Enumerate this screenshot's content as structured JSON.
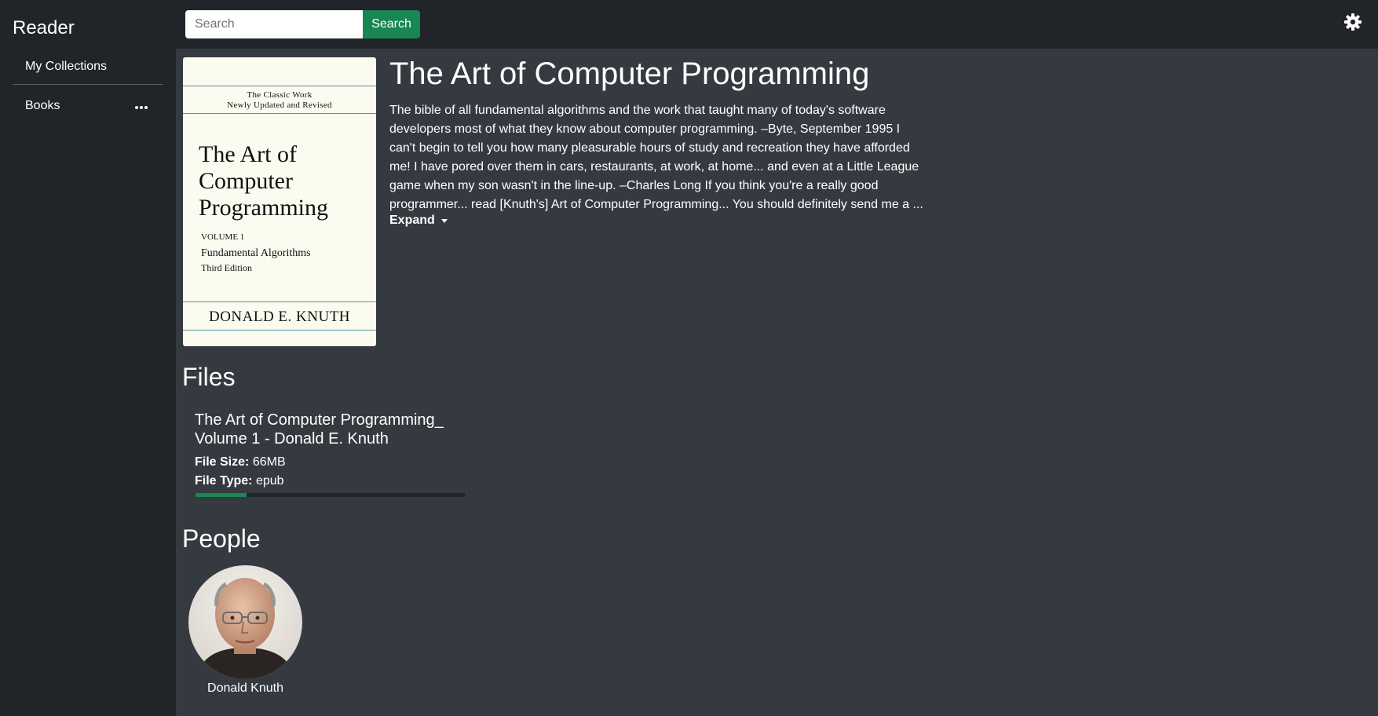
{
  "app": {
    "title": "Reader"
  },
  "sidebar": {
    "items": [
      {
        "label": "My Collections"
      },
      {
        "label": "Books"
      }
    ],
    "more_icon": "more-horizontal-icon"
  },
  "header": {
    "search": {
      "placeholder": "Search",
      "value": "",
      "button_label": "Search"
    },
    "settings_icon": "gear-icon"
  },
  "book": {
    "title": "The Art of Computer Programming",
    "description": " The bible of all fundamental algorithms and the work that taught many of today's software developers most of what they know about computer programming.  –Byte, September 1995    I can't begin to tell you how many pleasurable hours of study and recreation they have afforded me! I have pored over them in cars, restaurants, at work, at home... and even at a Little League game when my son wasn't in the line-up.  –Charles Long    If you think you're a really good programmer... read [Knuth's] Art of Computer Programming... You should definitely send me a ...",
    "expand_label": "Expand",
    "cover": {
      "tagline_1": "The Classic Work",
      "tagline_2": "Newly Updated and Revised",
      "title_line_1": "The Art of",
      "title_line_2": "Computer",
      "title_line_3": "Programming",
      "volume": "VOLUME 1",
      "subtitle": "Fundamental Algorithms",
      "edition": "Third Edition",
      "author": "DONALD E. KNUTH"
    }
  },
  "files": {
    "heading": "Files",
    "items": [
      {
        "name": "The Art of Computer Programming_ Volume 1 - Donald E. Knuth",
        "size_label": "File Size:",
        "size": "66MB",
        "type_label": "File Type:",
        "type": "epub",
        "progress": 0.19
      }
    ]
  },
  "people": {
    "heading": "People",
    "items": [
      {
        "name": "Donald Knuth"
      }
    ]
  },
  "colors": {
    "accent": "#198754",
    "sidebar_bg": "#212529",
    "main_bg": "#343a40"
  }
}
